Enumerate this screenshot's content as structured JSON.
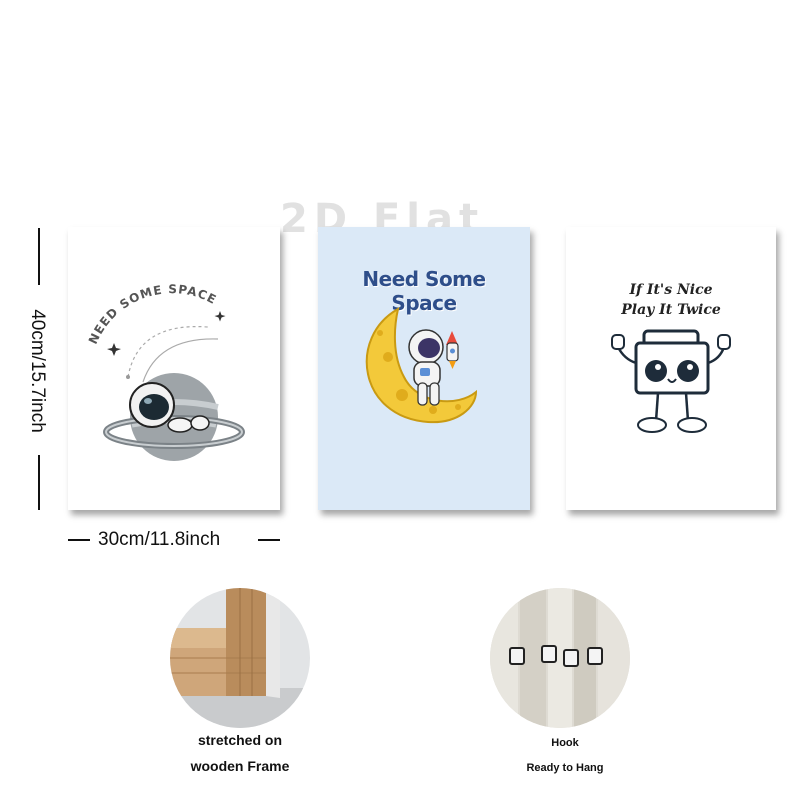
{
  "watermark": "2D Flat",
  "dimensions": {
    "height_label": "40cm/15.7inch",
    "width_label": "30cm/11.8inch"
  },
  "posters": [
    {
      "text": "NEED SOME SPACE",
      "background": "#ffffff",
      "icon": "astronaut-planet-icon"
    },
    {
      "text_line1": "Need Some",
      "text_line2": "Space",
      "background": "#dbe9f7",
      "icon": "astronaut-moon-icon"
    },
    {
      "text_line1": "If It's Nice",
      "text_line2": "Play It Twice",
      "background": "#ffffff",
      "icon": "boombox-icon"
    }
  ],
  "features": [
    {
      "line1": "stretched on",
      "line2": "wooden Frame",
      "icon": "wooden-frame-icon"
    },
    {
      "line1": "Hook",
      "line2": "Ready to Hang",
      "icon": "hook-icon"
    }
  ]
}
